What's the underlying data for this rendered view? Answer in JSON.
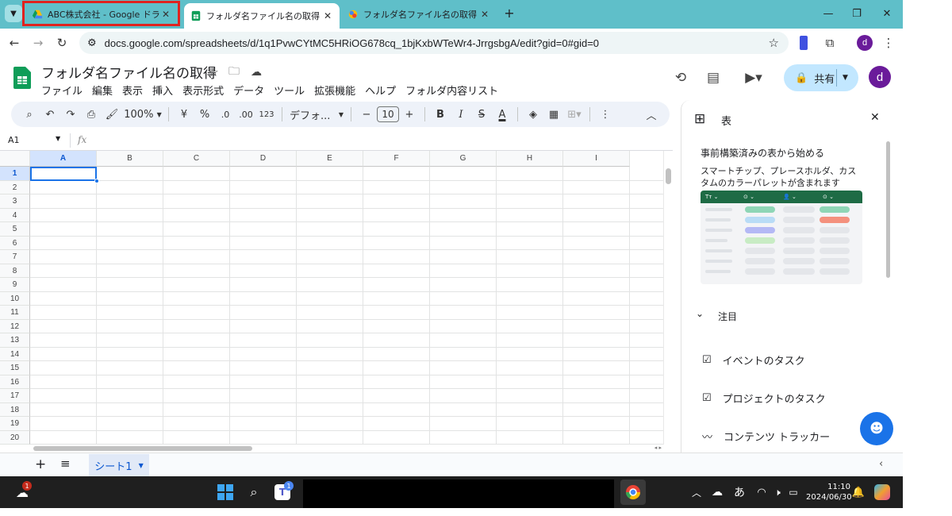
{
  "browser": {
    "tabs": [
      {
        "title": "ABC株式会社 - Google ドライブ",
        "close": "✕"
      },
      {
        "title": "フォルダ名ファイル名の取得 - Goog",
        "close": "✕"
      },
      {
        "title": "フォルダ名ファイル名の取得 - プロジ",
        "close": "✕"
      }
    ],
    "new_tab": "+",
    "url": "docs.google.com/spreadsheets/d/1q1PvwCYtMC5HRiOG678cq_1bjKxbWTeWr4-JrrgsbgA/edit?gid=0#gid=0",
    "profile_initial": "d"
  },
  "sheets": {
    "doc_title": "フォルダ名ファイル名の取得",
    "menu": [
      "ファイル",
      "編集",
      "表示",
      "挿入",
      "表示形式",
      "データ",
      "ツール",
      "拡張機能",
      "ヘルプ",
      "フォルダ内容リスト"
    ],
    "share_label": "共有",
    "profile_initial": "d",
    "toolbar": {
      "zoom": "100%",
      "currency": "¥",
      "percent": "%",
      "dec_decrease": ".0",
      "dec_increase": ".00",
      "number_format": "123",
      "font": "デフォ...",
      "font_size": "10",
      "bold": "B",
      "italic": "I",
      "strike": "S",
      "text_color": "A"
    },
    "name_box": "A1",
    "fx": "fx",
    "columns": [
      "A",
      "B",
      "C",
      "D",
      "E",
      "F",
      "G",
      "H",
      "I"
    ],
    "rows": [
      "1",
      "2",
      "3",
      "4",
      "5",
      "6",
      "7",
      "8",
      "9",
      "10",
      "11",
      "12",
      "13",
      "14",
      "15",
      "16",
      "17",
      "18",
      "19",
      "20"
    ],
    "sheet_tab": "シート1"
  },
  "side_panel": {
    "title": "表",
    "start_heading": "事前構築済みの表から始める",
    "start_desc": "スマートチップ、プレースホルダ、カスタムのカラーパレットが含まれます",
    "featured": "注目",
    "items": [
      "イベントのタスク",
      "プロジェクトのタスク",
      "コンテンツ トラッカー"
    ]
  },
  "taskbar": {
    "weather_badge": "1",
    "teams_badge": "1",
    "ime": "あ",
    "time": "11:10",
    "date": "2024/06/30"
  },
  "colors": {
    "tab_strip": "#5fbfc9",
    "highlight": "#e0221f",
    "sheets_green": "#0f9d58",
    "share_bg": "#c2e7ff",
    "avatar": "#6a1b9a"
  }
}
